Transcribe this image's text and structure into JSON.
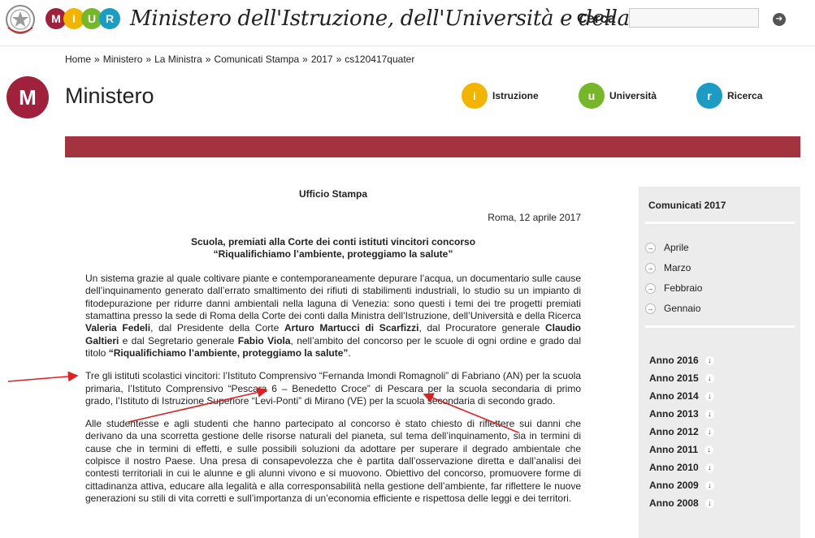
{
  "header": {
    "miur_letters": [
      "M",
      "I",
      "U",
      "R"
    ],
    "ministry_name": "Ministero dell'Istruzione, dell'Università e della Ricerca",
    "search_label": "Cerca",
    "search_value": "",
    "colors": {
      "m": "#a0213c",
      "i": "#f3b400",
      "u": "#76b72a",
      "r": "#1b9cc4"
    }
  },
  "breadcrumb": [
    "Home",
    "Ministero",
    "La Ministra",
    "Comunicati Stampa",
    "2017",
    "cs120417quater"
  ],
  "section": {
    "badge": "M",
    "title": "Ministero",
    "nav": [
      {
        "letter": "i",
        "label": "Istruzione",
        "color": "#f3b400"
      },
      {
        "letter": "u",
        "label": "Università",
        "color": "#76b72a"
      },
      {
        "letter": "r",
        "label": "Ricerca",
        "color": "#1b9cc4"
      }
    ]
  },
  "article": {
    "office": "Ufficio Stampa",
    "date": "Roma, 12 aprile 2017",
    "headline_1": "Scuola, premiati alla Corte dei conti istituti vincitori concorso",
    "headline_2": "“Riqualifichiamo l’ambiente, proteggiamo la salute”",
    "p1": {
      "a": "Un sistema grazie al quale coltivare piante e contemporaneamente depurare l’acqua, un documentario sulle cause dell’inquinamento generato dall’errato smaltimento dei rifiuti di stabilimenti industriali, lo studio su un impianto di fitodepurazione per ridurre danni ambientali nella laguna di Venezia: sono questi i temi dei tre progetti premiati stamattina presso la sede di Roma della Corte dei conti dalla Ministra dell’Istruzione, dell’Università e della Ricerca ",
      "b": "Valeria Fedeli",
      "c": ", dal Presidente della Corte ",
      "d": "Arturo Martucci di Scarfizzi",
      "e": ", dal Procuratore generale ",
      "f": "Claudio Galtieri",
      "g": " e dal Segretario generale ",
      "h": "Fabio Viola",
      "i": ", nell’ambito del concorso per le scuole di ogni ordine e grado dal titolo ",
      "j": "“Riqualifichiamo l’ambiente, proteggiamo la salute”",
      "k": "."
    },
    "p2": "Tre gli istituti scolastici vincitori: l’Istituto Comprensivo “Fernanda Imondi Romagnoli” di Fabriano (AN) per la scuola primaria, l’Istituto Comprensivo “Pescara 6 – Benedetto Croce” di Pescara per la scuola secondaria di primo grado, l’Istituto di Istruzione Superiore “Levi-Ponti” di Mirano (VE) per la scuola secondaria di secondo grado.",
    "p3": "Alle studentesse e agli studenti che hanno partecipato al concorso è stato chiesto di riflettere sui danni che derivano da una scorretta gestione delle risorse naturali del pianeta, sul tema dell’inquinamento, sia in termini di cause che in termini di effetti, e sulle possibili soluzioni da adottare per superare il degrado ambientale che colpisce il nostro Paese. Una presa di consapevolezza che è partita dall’osservazione diretta e dall’analisi dei contesti territoriali in cui le alunne e gli alunni vivono e si muovono. Obiettivo del concorso, promuovere forme di cittadinanza attiva, educare alla legalità e alla corresponsabilità nella gestione dell’ambiente, far riflettere le nuove generazioni su stili di vita corretti e sull’importanza di un’economia efficiente e rispettosa delle leggi e dei territori."
  },
  "sidebar": {
    "title": "Comunicati 2017",
    "months": [
      "Aprile",
      "Marzo",
      "Febbraio",
      "Gennaio"
    ],
    "years": [
      "Anno 2016",
      "Anno 2015",
      "Anno 2014",
      "Anno 2013",
      "Anno 2012",
      "Anno 2011",
      "Anno 2010",
      "Anno 2009",
      "Anno 2008"
    ]
  },
  "annotation_color": "#e02020"
}
